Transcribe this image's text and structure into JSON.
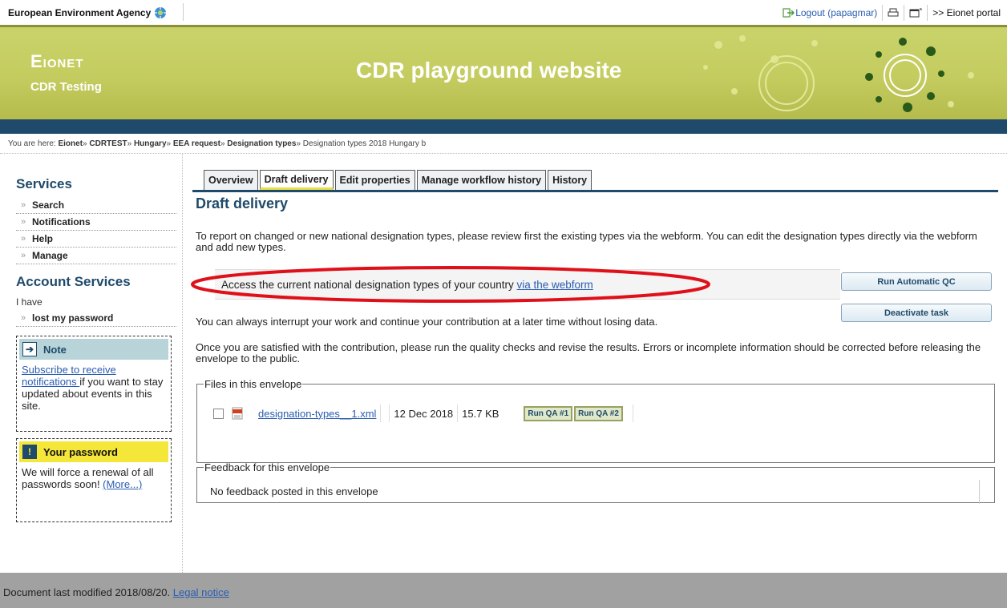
{
  "topbar": {
    "agency": "European Environment Agency",
    "logout": "Logout (papagmar)",
    "portal": ">> Eionet portal"
  },
  "banner": {
    "site_name": "Eionet",
    "site_sub": "CDR Testing",
    "title": "CDR playground website"
  },
  "breadcrumb": {
    "prefix": "You are here:",
    "items": [
      "Eionet",
      "CDRTEST",
      "Hungary",
      "EEA request",
      "Designation types"
    ],
    "current": "Designation types 2018 Hungary b"
  },
  "sidebar": {
    "services_title": "Services",
    "services": [
      "Search",
      "Notifications",
      "Help",
      "Manage"
    ],
    "account_title": "Account Services",
    "i_have": "I have",
    "lost_password": "lost my password",
    "note": {
      "title": "Note",
      "link": "Subscribe to receive notifications ",
      "text": "if you want to stay updated about events in this site."
    },
    "password": {
      "title": "Your password",
      "text": "We will force a renewal of all passwords soon! ",
      "more": "(More...)"
    }
  },
  "tabs": [
    "Overview",
    "Draft delivery",
    "Edit properties",
    "Manage workflow history",
    "History"
  ],
  "active_tab": "Draft delivery",
  "main": {
    "title": "Draft delivery",
    "p1": "To report on changed or new national designation types, please review first the existing types via the webform. You can edit the designation types directly via the webform and add new types.",
    "webform_text": "Access the current national designation types of your country ",
    "webform_link": "via the webform",
    "p2": "You can always interrupt your work and continue your contribution at a later time without losing data.",
    "p3": "Once you are satisfied with the contribution, please run the quality checks and revise the results. Errors or incomplete information should be corrected before releasing the envelope to the public.",
    "btn_qc": "Run Automatic QC",
    "btn_deactivate": "Deactivate task"
  },
  "files": {
    "legend": "Files in this envelope",
    "rows": [
      {
        "name": "designation-types__1.xml",
        "date": "12 Dec 2018",
        "size": "15.7 KB",
        "qa1": "Run QA #1",
        "qa2": "Run QA #2"
      }
    ]
  },
  "feedback": {
    "legend": "Feedback for this envelope",
    "text": "No feedback posted in this envelope"
  },
  "footer": {
    "text": "Document last modified 2018/08/20. ",
    "link": "Legal notice"
  },
  "colors": {
    "brand_navy": "#1f4a6b",
    "banner_green": "#c4cc5f",
    "highlight_red": "#e0101a",
    "note_blue": "#b8d4d9",
    "warning_yellow": "#f5e63a"
  }
}
